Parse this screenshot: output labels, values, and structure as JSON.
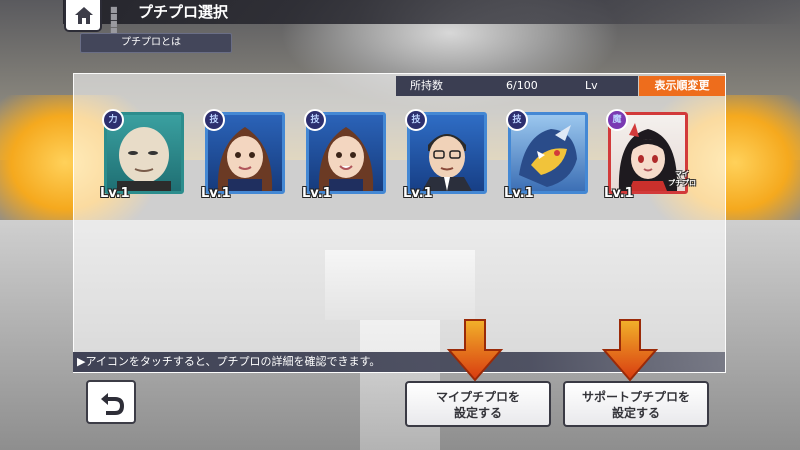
{
  "header": {
    "title": "プチプロ選択",
    "about_button": "プチプロとは",
    "home_icon": "home-icon"
  },
  "panel": {
    "count_label": "所持数",
    "count_value": "6/100",
    "sort_type": "Lv",
    "sort_button": "表示順変更"
  },
  "units": [
    {
      "level": "Lv.1",
      "attribute": "力",
      "frame": "green"
    },
    {
      "level": "Lv.1",
      "attribute": "技",
      "frame": "blue"
    },
    {
      "level": "Lv.1",
      "attribute": "技",
      "frame": "blue"
    },
    {
      "level": "Lv.1",
      "attribute": "技",
      "frame": "blue"
    },
    {
      "level": "Lv.1",
      "attribute": "技",
      "frame": "blue"
    },
    {
      "level": "Lv.1",
      "attribute": "魔",
      "frame": "red",
      "tag": "マイ\nプチプロ"
    }
  ],
  "footer": {
    "hint": "▶アイコンをタッチすると、プチプロの詳細を確認できます。",
    "my_button_line1": "マイプチプロを",
    "my_button_line2": "設定する",
    "support_button_line1": "サポートプチプロを",
    "support_button_line2": "設定する",
    "back_icon": "back-arrow-icon"
  },
  "colors": {
    "accent_orange": "#ee6d1c",
    "dark_bar": "#3b3e52",
    "frame_blue": "#4488d4",
    "frame_green": "#2c8d8d",
    "frame_red": "#d23a3a"
  }
}
